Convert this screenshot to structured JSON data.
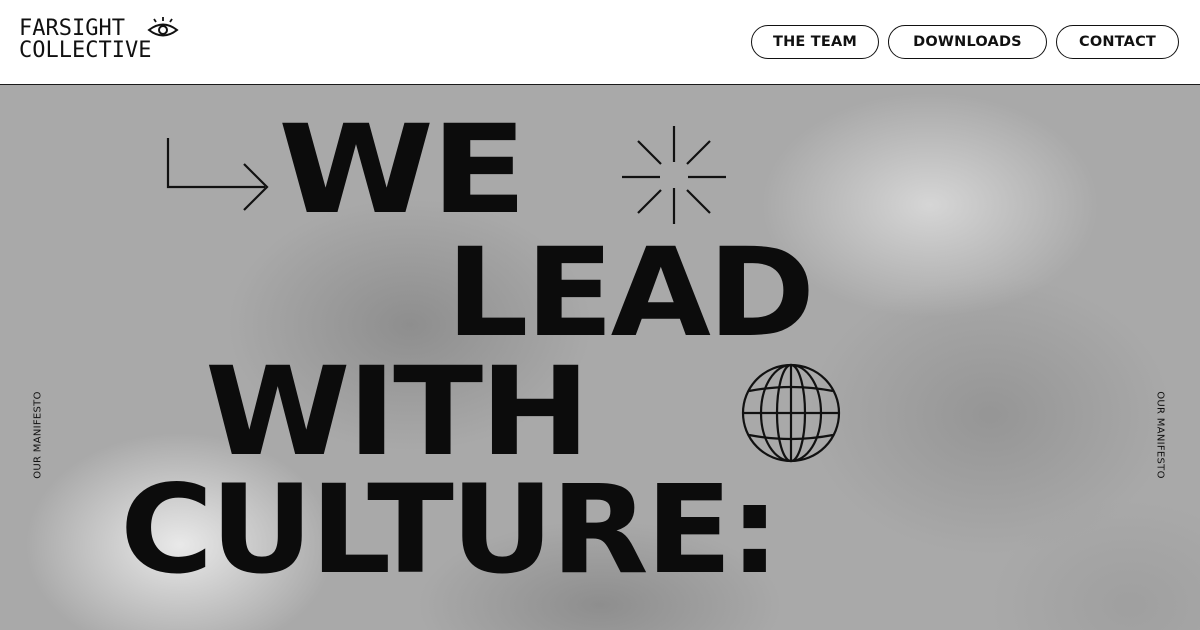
{
  "brand": {
    "line1": "FARSIGHT",
    "line2": "COLLECTIVE",
    "icon": "eye-icon"
  },
  "nav": {
    "items": [
      {
        "label": "THE TEAM"
      },
      {
        "label": "DOWNLOADS"
      },
      {
        "label": "CONTACT"
      }
    ]
  },
  "hero": {
    "side_label_left": "OUR MANIFESTO",
    "side_label_right": "OUR MANIFESTO",
    "headline": [
      "WE",
      "LEAD",
      "WITH",
      "CULTURE:"
    ],
    "icons": [
      "arrow-icon",
      "sparkle-icon",
      "globe-icon"
    ]
  },
  "colors": {
    "ink": "#0c0c0c",
    "background": "#a9a9a9",
    "header_bg": "#ffffff"
  }
}
